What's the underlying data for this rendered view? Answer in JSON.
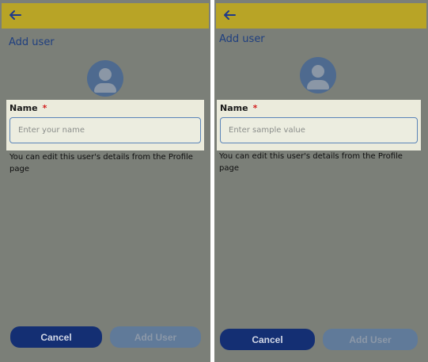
{
  "colors": {
    "overlay_gray": "#7b7f78",
    "app_bar": "#b8a426",
    "primary_navy": "#142f73",
    "disabled_button": "#607a99",
    "required_red": "#d32020",
    "input_border": "#5a84b8"
  },
  "screens": [
    {
      "back_icon": "arrow-left-icon",
      "title": "Add user",
      "avatar_icon": "user-avatar-icon",
      "field_label": "Name",
      "required_marker": "*",
      "input_placeholder": "Enter your name",
      "input_value": "",
      "helper_text": "You can edit this user's details from the Profile page",
      "cancel_label": "Cancel",
      "add_label": "Add User"
    },
    {
      "back_icon": "arrow-left-icon",
      "title": "Add user",
      "avatar_icon": "user-avatar-icon",
      "field_label": "Name",
      "required_marker": "*",
      "input_placeholder": "Enter sample value",
      "input_value": "",
      "helper_text": "You can edit this user's details from the Profile page",
      "cancel_label": "Cancel",
      "add_label": "Add User"
    }
  ]
}
